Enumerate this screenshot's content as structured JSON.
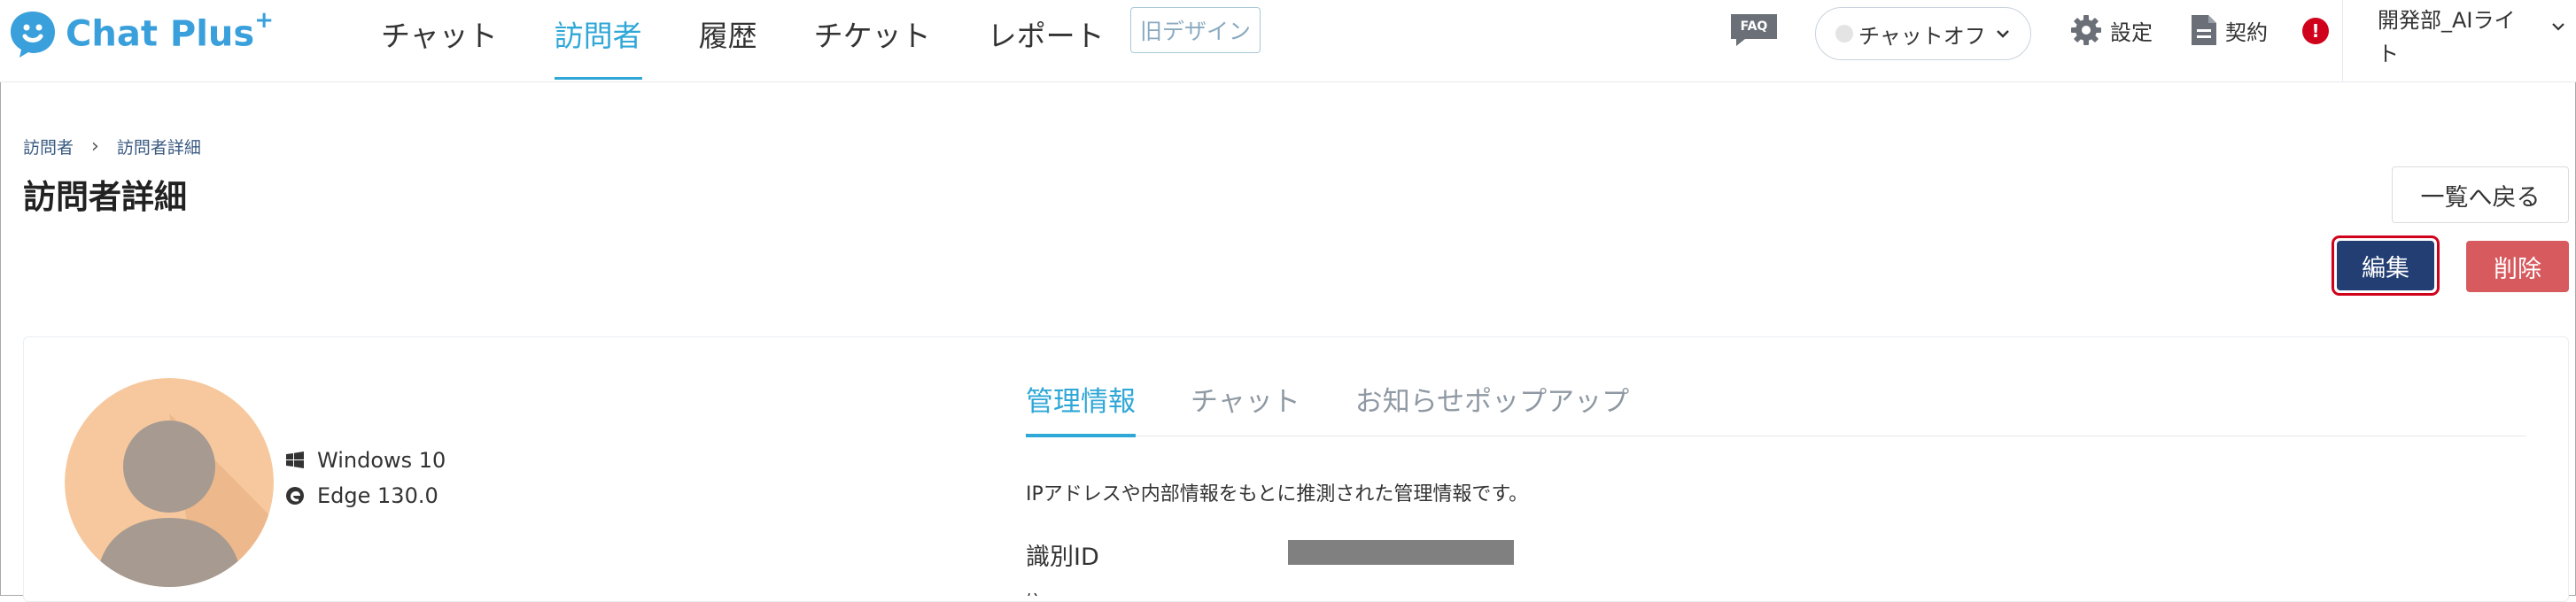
{
  "app": {
    "logo_text": "Chat Plus",
    "logo_sup": "+"
  },
  "nav": {
    "items": [
      {
        "label": "チャット",
        "active": false
      },
      {
        "label": "訪問者",
        "active": true
      },
      {
        "label": "履歴",
        "active": false
      },
      {
        "label": "チケット",
        "active": false
      },
      {
        "label": "レポート",
        "active": false
      }
    ],
    "old_design_label": "旧デザイン"
  },
  "header": {
    "faq_label": "FAQ",
    "chat_status_label": "チャットオフ",
    "settings_label": "設定",
    "contract_label": "契約",
    "alert_glyph": "!",
    "account_name": "開発部_AIライト"
  },
  "breadcrumb": {
    "items": [
      "訪問者",
      "訪問者詳細"
    ],
    "separator": "›"
  },
  "page": {
    "title": "訪問者詳細",
    "back_label": "一覧へ戻る",
    "edit_label": "編集",
    "delete_label": "削除"
  },
  "visitor": {
    "os": "Windows 10",
    "browser": "Edge 130.0"
  },
  "tabs": [
    {
      "label": "管理情報",
      "active": true
    },
    {
      "label": "チャット",
      "active": false
    },
    {
      "label": "お知らせポップアップ",
      "active": false
    }
  ],
  "management": {
    "description": "IPアドレスや内部情報をもとに推測された管理情報です。",
    "fields": [
      {
        "label": "識別ID",
        "value_masked": true
      }
    ]
  },
  "colors": {
    "accent": "#2fa7d7",
    "brand": "#3aa0dc",
    "edit_bg": "#223e73",
    "edit_highlight": "#d0021b",
    "delete_bg": "#d75a5f"
  }
}
